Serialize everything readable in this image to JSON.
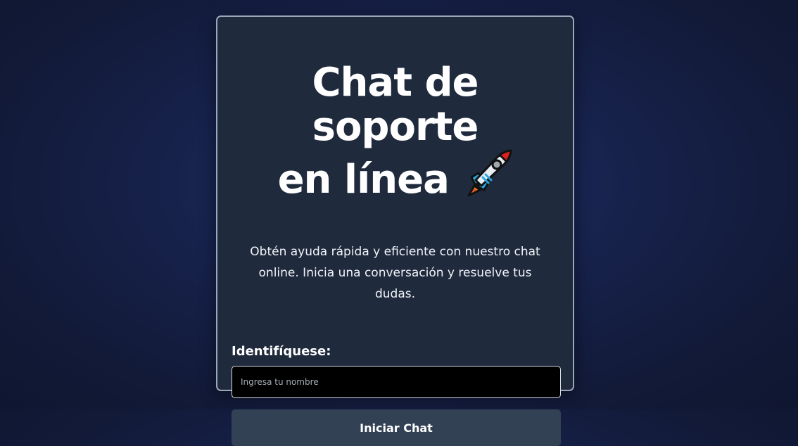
{
  "card": {
    "title_line1": "Chat de soporte",
    "title_line2": "en línea",
    "title_icon": "rocket-icon",
    "subtitle": "Obtén ayuda rápida y eficiente con nuestro chat online. Inicia una conversación y resuelve tus dudas.",
    "form": {
      "label": "Identifíquese:",
      "name_placeholder": "Ingresa tu nombre",
      "name_value": "",
      "start_button_label": "Iniciar Chat"
    }
  },
  "colors": {
    "card_background": "#1f2a3d",
    "card_border": "#9aa7b8",
    "button_background": "#334155",
    "input_background": "#000000",
    "text": "#ffffff"
  }
}
